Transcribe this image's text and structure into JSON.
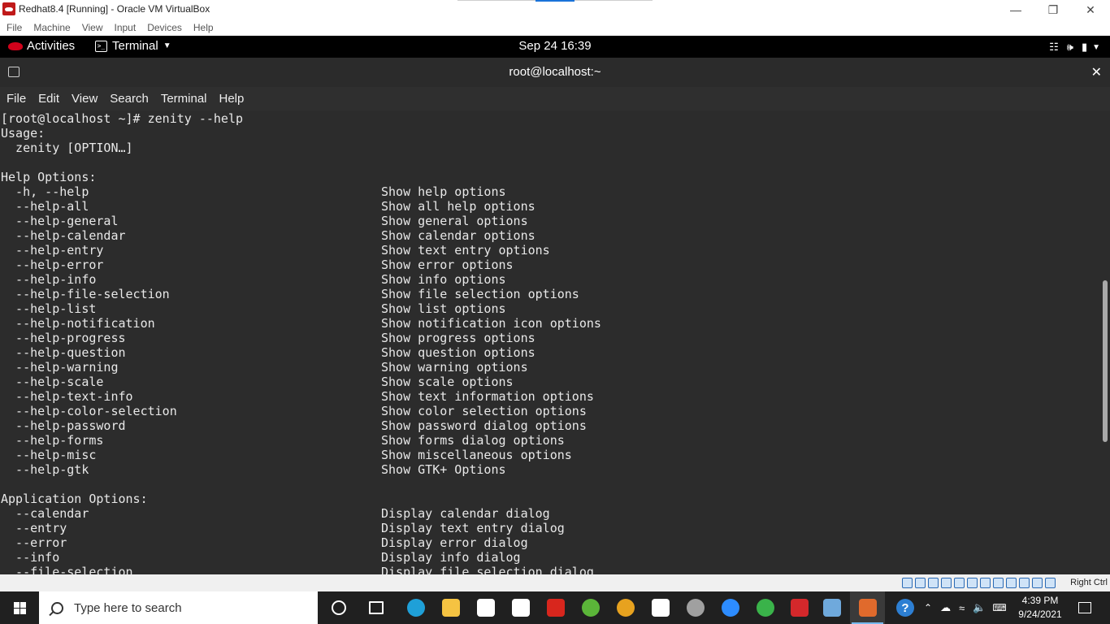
{
  "virtualbox": {
    "title": "Redhat8.4 [Running] - Oracle VM VirtualBox",
    "menu": [
      "File",
      "Machine",
      "View",
      "Input",
      "Devices",
      "Help"
    ],
    "host_key_label": "Right Ctrl"
  },
  "gnome": {
    "activities": "Activities",
    "app_menu": "Terminal",
    "clock": "Sep 24  16:39"
  },
  "terminal": {
    "window_title": "root@localhost:~",
    "menu": [
      "File",
      "Edit",
      "View",
      "Search",
      "Terminal",
      "Help"
    ],
    "lines": [
      {
        "a": "[root@localhost ~]# zenity --help",
        "b": ""
      },
      {
        "a": "Usage:",
        "b": ""
      },
      {
        "a": "  zenity [OPTION…]",
        "b": ""
      },
      {
        "a": "",
        "b": ""
      },
      {
        "a": "Help Options:",
        "b": ""
      },
      {
        "a": "  -h, --help",
        "b": "Show help options"
      },
      {
        "a": "  --help-all",
        "b": "Show all help options"
      },
      {
        "a": "  --help-general",
        "b": "Show general options"
      },
      {
        "a": "  --help-calendar",
        "b": "Show calendar options"
      },
      {
        "a": "  --help-entry",
        "b": "Show text entry options"
      },
      {
        "a": "  --help-error",
        "b": "Show error options"
      },
      {
        "a": "  --help-info",
        "b": "Show info options"
      },
      {
        "a": "  --help-file-selection",
        "b": "Show file selection options"
      },
      {
        "a": "  --help-list",
        "b": "Show list options"
      },
      {
        "a": "  --help-notification",
        "b": "Show notification icon options"
      },
      {
        "a": "  --help-progress",
        "b": "Show progress options"
      },
      {
        "a": "  --help-question",
        "b": "Show question options"
      },
      {
        "a": "  --help-warning",
        "b": "Show warning options"
      },
      {
        "a": "  --help-scale",
        "b": "Show scale options"
      },
      {
        "a": "  --help-text-info",
        "b": "Show text information options"
      },
      {
        "a": "  --help-color-selection",
        "b": "Show color selection options"
      },
      {
        "a": "  --help-password",
        "b": "Show password dialog options"
      },
      {
        "a": "  --help-forms",
        "b": "Show forms dialog options"
      },
      {
        "a": "  --help-misc",
        "b": "Show miscellaneous options"
      },
      {
        "a": "  --help-gtk",
        "b": "Show GTK+ Options"
      },
      {
        "a": "",
        "b": ""
      },
      {
        "a": "Application Options:",
        "b": ""
      },
      {
        "a": "  --calendar",
        "b": "Display calendar dialog"
      },
      {
        "a": "  --entry",
        "b": "Display text entry dialog"
      },
      {
        "a": "  --error",
        "b": "Display error dialog"
      },
      {
        "a": "  --info",
        "b": "Display info dialog"
      },
      {
        "a": "  --file-selection",
        "b": "Display file selection dialog"
      }
    ]
  },
  "taskbar": {
    "search_placeholder": "Type here to search",
    "time": "4:39 PM",
    "date": "9/24/2021",
    "apps": [
      {
        "name": "cortana",
        "color": "#ffffff"
      },
      {
        "name": "task-view",
        "color": "#ffffff"
      },
      {
        "name": "edge",
        "color": "#1fa0d8"
      },
      {
        "name": "file-explorer",
        "color": "#f5c342"
      },
      {
        "name": "dropbox",
        "color": "#ffffff"
      },
      {
        "name": "app-lightning",
        "color": "#ffffff"
      },
      {
        "name": "acrobat",
        "color": "#d8261d"
      },
      {
        "name": "utorrent",
        "color": "#5bb539"
      },
      {
        "name": "chrome",
        "color": "#e7a21f"
      },
      {
        "name": "settings",
        "color": "#ffffff"
      },
      {
        "name": "camera",
        "color": "#a0a0a0"
      },
      {
        "name": "zoom",
        "color": "#2d8cff"
      },
      {
        "name": "app-ring",
        "color": "#3ab34a"
      },
      {
        "name": "redhat-vm",
        "color": "#d4282b"
      },
      {
        "name": "virtualbox",
        "color": "#6fa9dc"
      },
      {
        "name": "vm-active",
        "color": "#e06a2c"
      }
    ]
  },
  "colors": {
    "terminal_bg": "#2c2c2c",
    "terminal_text": "#e8e8e8",
    "gnome_bar": "#000000",
    "taskbar": "#202020",
    "accent": "#76b9ed"
  }
}
